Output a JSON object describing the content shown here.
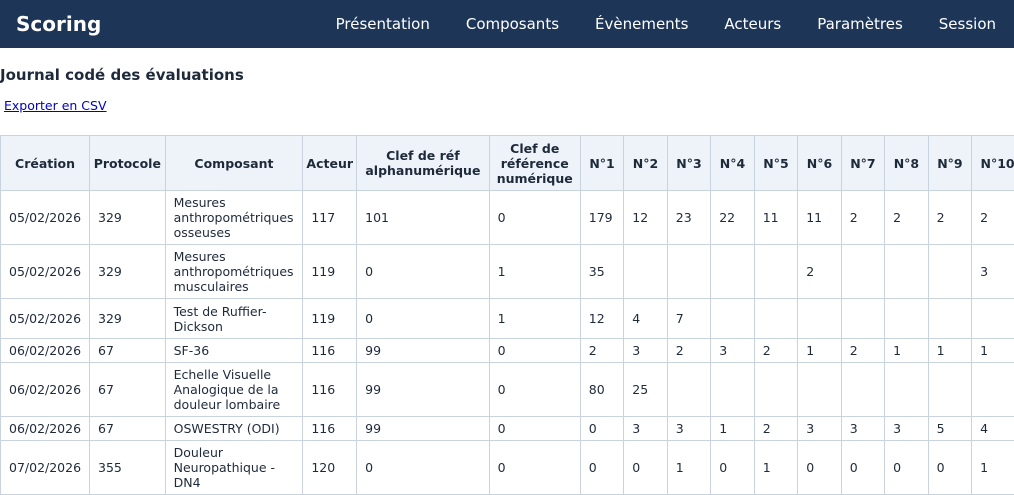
{
  "app": {
    "brand": "Scoring",
    "nav": [
      "Présentation",
      "Composants",
      "Évènements",
      "Acteurs",
      "Paramètres",
      "Session"
    ]
  },
  "page": {
    "title": "Journal codé des évaluations",
    "export_label": "Exporter en CSV"
  },
  "table": {
    "headers": [
      "Création",
      "Protocole",
      "Composant",
      "Acteur",
      "Clef de réf alphanumérique",
      "Clef de référence numérique",
      "N°1",
      "N°2",
      "N°3",
      "N°4",
      "N°5",
      "N°6",
      "N°7",
      "N°8",
      "N°9",
      "N°10"
    ],
    "rows": [
      [
        "05/02/2026",
        "329",
        "Mesures anthropométriques osseuses",
        "117",
        "101",
        "0",
        "179",
        "12",
        "23",
        "22",
        "11",
        "11",
        "2",
        "2",
        "2",
        "2"
      ],
      [
        "05/02/2026",
        "329",
        "Mesures anthropométriques musculaires",
        "119",
        "0",
        "1",
        "35",
        "",
        "",
        "",
        "",
        "2",
        "",
        "",
        "",
        "3"
      ],
      [
        "05/02/2026",
        "329",
        "Test de Ruffier-Dickson",
        "119",
        "0",
        "1",
        "12",
        "4",
        "7",
        "",
        "",
        "",
        "",
        "",
        "",
        ""
      ],
      [
        "06/02/2026",
        "67",
        "SF-36",
        "116",
        "99",
        "0",
        "2",
        "3",
        "2",
        "3",
        "2",
        "1",
        "2",
        "1",
        "1",
        "1"
      ],
      [
        "06/02/2026",
        "67",
        "Echelle Visuelle Analogique de la douleur lombaire",
        "116",
        "99",
        "0",
        "80",
        "25",
        "",
        "",
        "",
        "",
        "",
        "",
        "",
        ""
      ],
      [
        "06/02/2026",
        "67",
        "OSWESTRY (ODI)",
        "116",
        "99",
        "0",
        "0",
        "3",
        "3",
        "1",
        "2",
        "3",
        "3",
        "3",
        "5",
        "4"
      ],
      [
        "07/02/2026",
        "355",
        "Douleur Neuropathique - DN4",
        "120",
        "0",
        "0",
        "0",
        "0",
        "1",
        "0",
        "1",
        "0",
        "0",
        "0",
        "0",
        "1"
      ]
    ]
  },
  "colors": {
    "topbar": "#1d3557",
    "header_bg": "#eef3f9",
    "link": "#0000cc",
    "border": "#c9d3de"
  }
}
